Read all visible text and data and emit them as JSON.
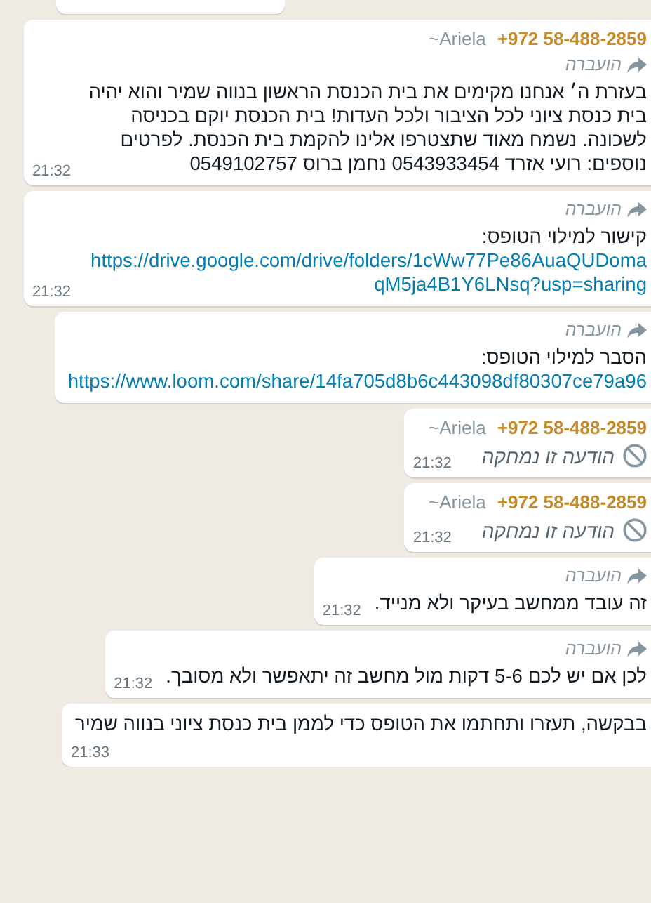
{
  "messages": [
    {
      "kind": "clipped"
    },
    {
      "kind": "text",
      "sender": {
        "phone": "+972 58-488-2859",
        "name": "~Ariela"
      },
      "forwarded": true,
      "forwarded_label": "הועברה",
      "body": "בעזרת ה׳ אנחנו מקימים את בית הכנסת הראשון בנווה שמיר והוא יהיה בית כנסת ציוני לכל הציבור ולכל העדות! בית הכנסת יוקם בכניסה לשכונה. נשמח מאוד שתצטרפו אלינו להקמת בית הכנסת. לפרטים נוספים: רועי אזרד 0543933454 נחמן ברוס 0549102757",
      "time": "21:32"
    },
    {
      "kind": "text",
      "forwarded": true,
      "forwarded_label": "הועברה",
      "body": "קישור למילוי הטופס:",
      "link": "https://drive.google.com/drive/folders/1cWw77Pe86AuaQUDomaqM5ja4B1Y6LNsq?usp=sharing",
      "time": "21:32"
    },
    {
      "kind": "text",
      "forwarded": true,
      "forwarded_label": "הועברה",
      "body": "הסבר למילוי הטופס:",
      "link": "https://www.loom.com/share/14fa705d8b6c443098df80307ce79a96"
    },
    {
      "kind": "deleted",
      "sender": {
        "phone": "+972 58-488-2859",
        "name": "~Ariela"
      },
      "body": "הודעה זו נמחקה",
      "time": "21:32"
    },
    {
      "kind": "deleted",
      "sender": {
        "phone": "+972 58-488-2859",
        "name": "~Ariela"
      },
      "body": "הודעה זו נמחקה",
      "time": "21:32"
    },
    {
      "kind": "text",
      "forwarded": true,
      "forwarded_label": "הועברה",
      "body": "זה עובד ממחשב בעיקר ולא מנייד.",
      "time": "21:32"
    },
    {
      "kind": "text",
      "forwarded": true,
      "forwarded_label": "הועברה",
      "body": "לכן אם יש לכם 5-6 דקות מול מחשב זה יתאפשר ולא מסובך.",
      "time": "21:32"
    },
    {
      "kind": "text",
      "forwarded": false,
      "body": "בבקשה, תעזרו ותחתמו את הטופס כדי לממן בית כנסת ציוני בנווה שמיר",
      "time": "21:33"
    }
  ]
}
